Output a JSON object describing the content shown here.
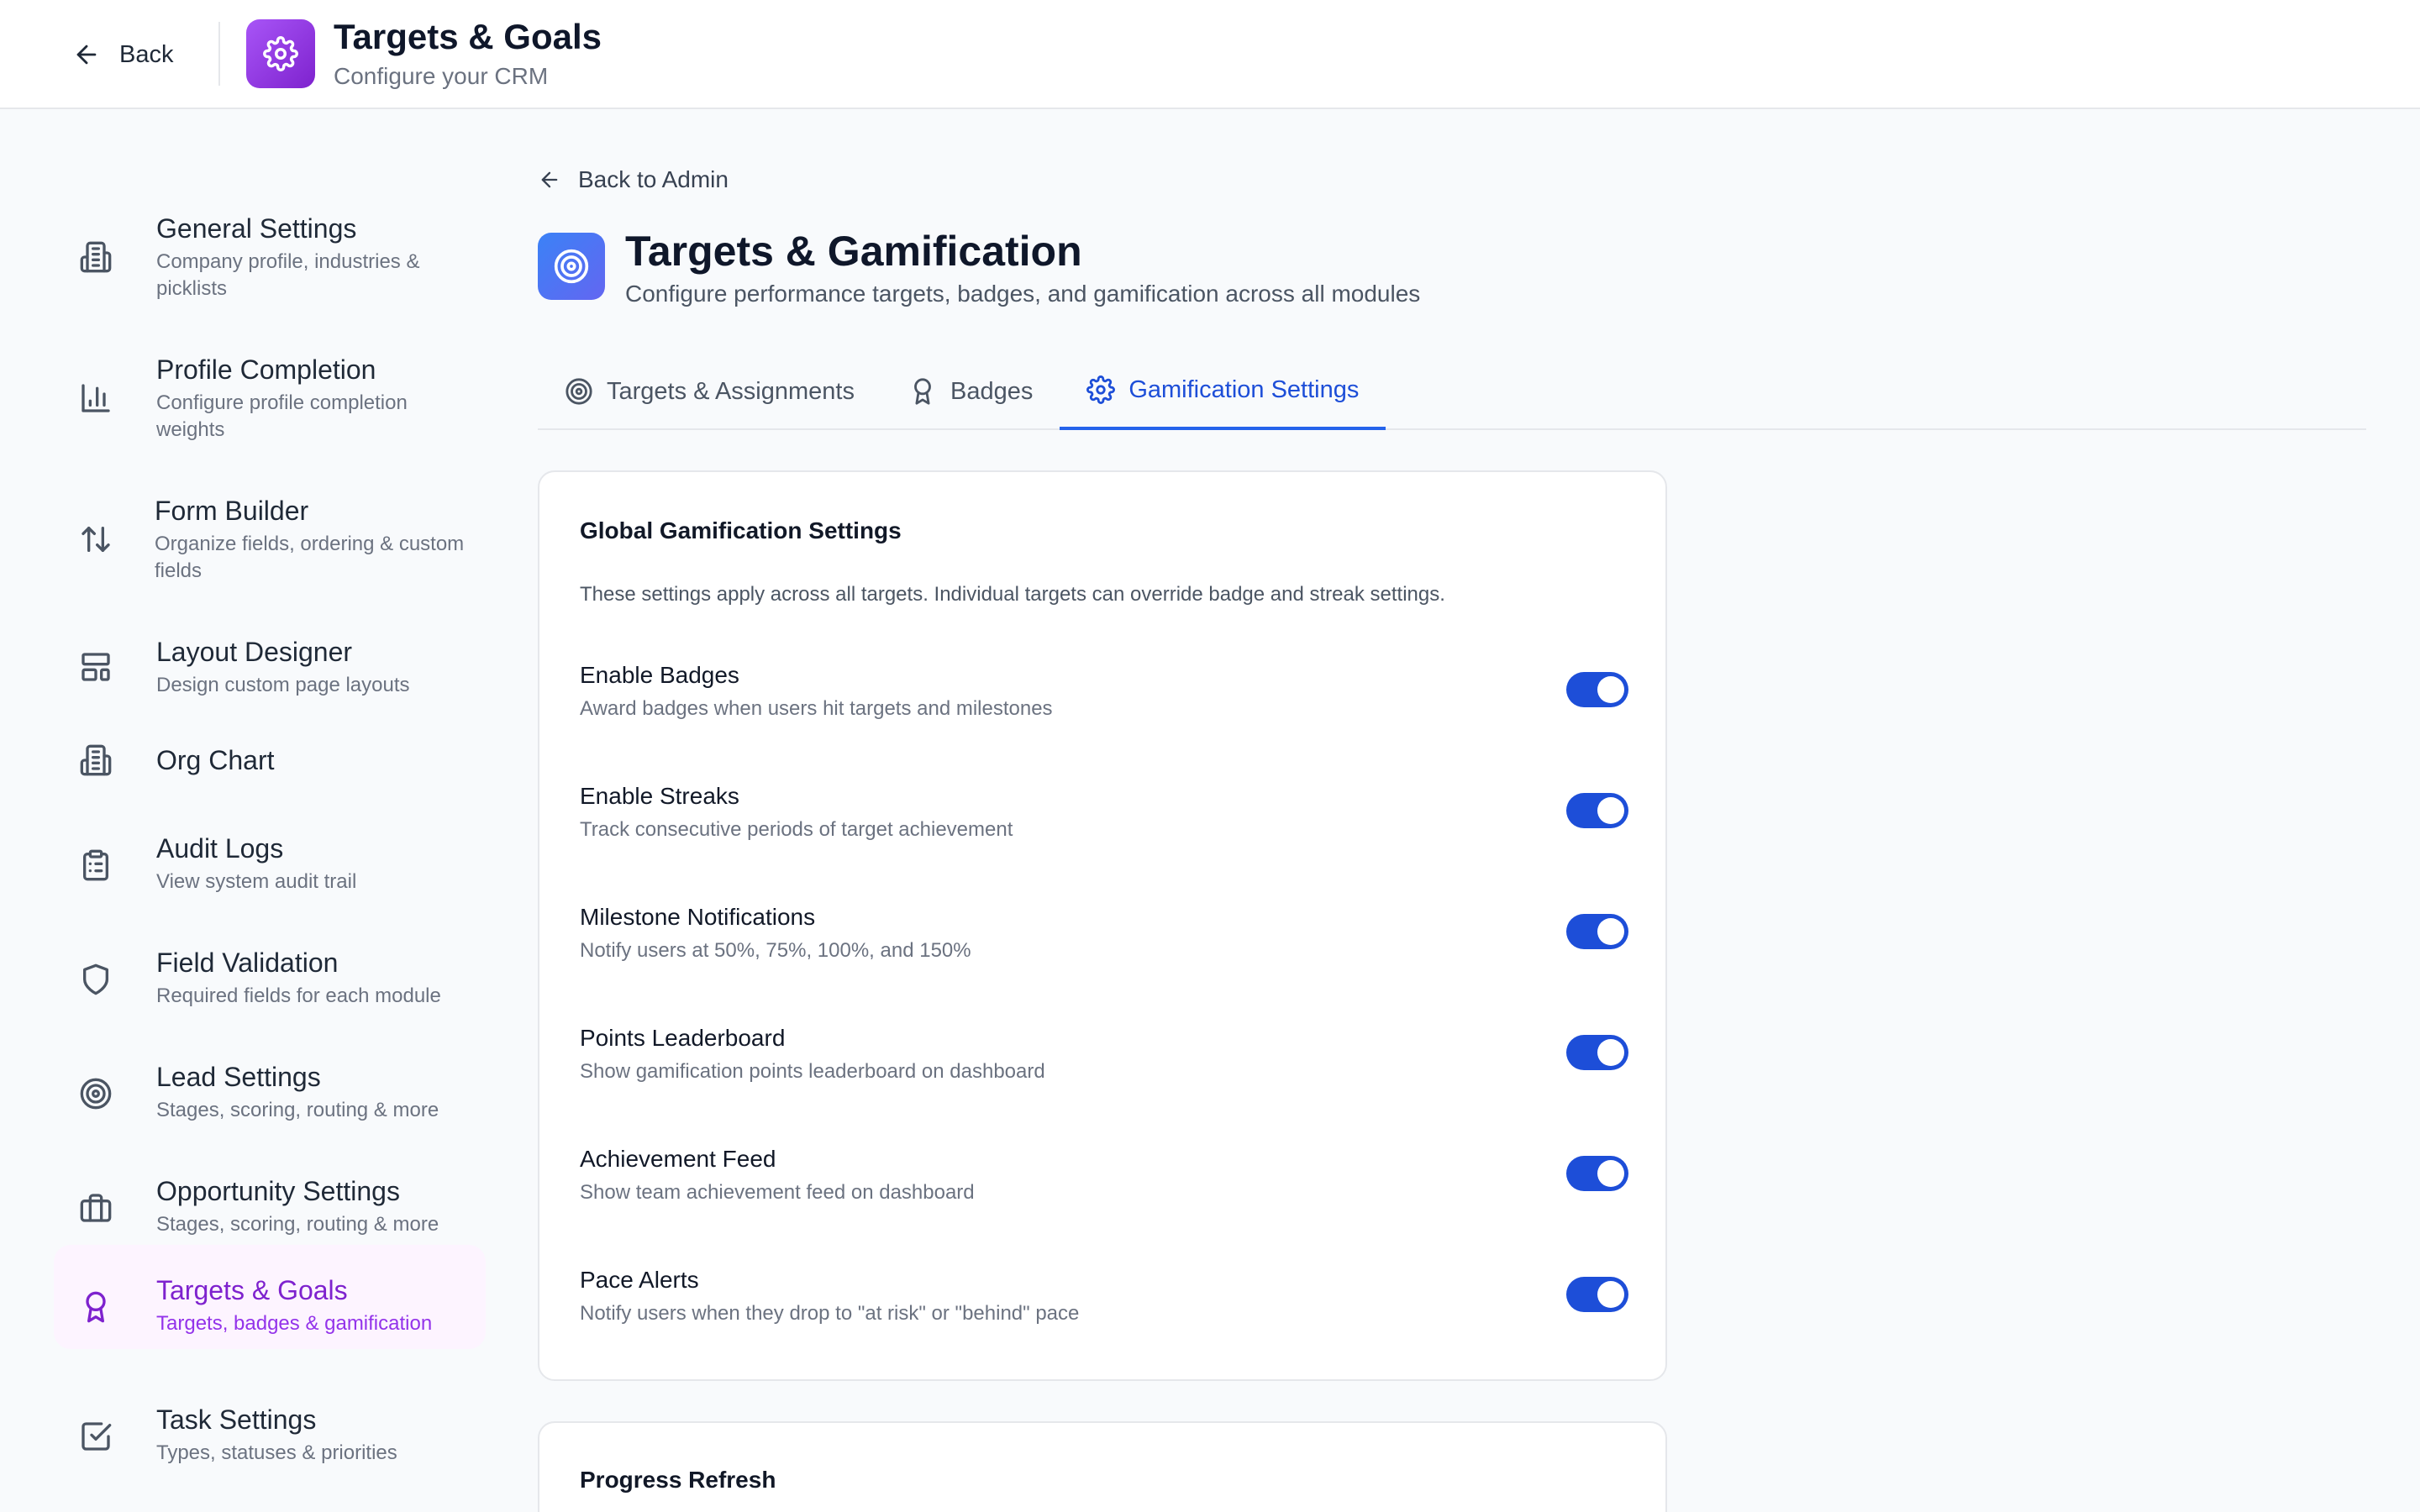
{
  "header": {
    "back_label": "Back",
    "app_title": "Targets & Goals",
    "app_subtitle": "Configure your CRM"
  },
  "sidebar": {
    "items": [
      {
        "label": "General Settings",
        "description": "Company profile, industries & picklists",
        "icon": "building-icon"
      },
      {
        "label": "Profile Completion",
        "description": "Configure profile completion weights",
        "icon": "bar-chart-icon"
      },
      {
        "label": "Form Builder",
        "description": "Organize fields, ordering & custom fields",
        "icon": "sort-arrows-icon"
      },
      {
        "label": "Layout Designer",
        "description": "Design custom page layouts",
        "icon": "layout-icon"
      },
      {
        "label": "Org Chart",
        "description": "",
        "icon": "building-icon"
      },
      {
        "label": "Audit Logs",
        "description": "View system audit trail",
        "icon": "clipboard-icon"
      },
      {
        "label": "Field Validation",
        "description": "Required fields for each module",
        "icon": "shield-icon"
      },
      {
        "label": "Lead Settings",
        "description": "Stages, scoring, routing & more",
        "icon": "target-icon"
      },
      {
        "label": "Opportunity Settings",
        "description": "Stages, scoring, routing & more",
        "icon": "briefcase-icon"
      },
      {
        "label": "Targets & Goals",
        "description": "Targets, badges & gamification",
        "icon": "award-icon",
        "active": true
      },
      {
        "label": "Task Settings",
        "description": "Types, statuses & priorities",
        "icon": "check-square-icon"
      }
    ]
  },
  "main": {
    "back_link": "Back to Admin",
    "title": "Targets & Gamification",
    "subtitle": "Configure performance targets, badges, and gamification across all modules",
    "tabs": [
      {
        "label": "Targets & Assignments",
        "icon": "target-icon"
      },
      {
        "label": "Badges",
        "icon": "award-icon"
      },
      {
        "label": "Gamification Settings",
        "icon": "gear-icon",
        "active": true
      }
    ]
  },
  "global_settings": {
    "title": "Global Gamification Settings",
    "description": "These settings apply across all targets. Individual targets can override badge and streak settings.",
    "settings": [
      {
        "label": "Enable Badges",
        "description": "Award badges when users hit targets and milestones",
        "enabled": true
      },
      {
        "label": "Enable Streaks",
        "description": "Track consecutive periods of target achievement",
        "enabled": true
      },
      {
        "label": "Milestone Notifications",
        "description": "Notify users at 50%, 75%, 100%, and 150%",
        "enabled": true
      },
      {
        "label": "Points Leaderboard",
        "description": "Show gamification points leaderboard on dashboard",
        "enabled": true
      },
      {
        "label": "Achievement Feed",
        "description": "Show team achievement feed on dashboard",
        "enabled": true
      },
      {
        "label": "Pace Alerts",
        "description": "Notify users when they drop to \"at risk\" or \"behind\" pace",
        "enabled": true
      }
    ]
  },
  "progress_refresh": {
    "title": "Progress Refresh"
  },
  "colors": {
    "accent": "#1d4ed8",
    "active_nav": "#7e22ce",
    "active_nav_bg": "#fdf4ff"
  }
}
